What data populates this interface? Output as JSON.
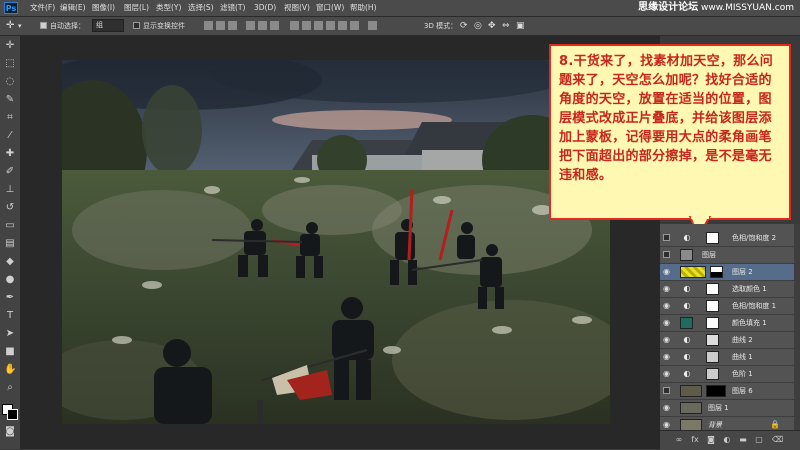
{
  "app": {
    "logo": "Ps"
  },
  "menu": [
    "文件(F)",
    "编辑(E)",
    "图像(I)",
    "图层(L)",
    "类型(Y)",
    "选择(S)",
    "滤镜(T)",
    "3D(D)",
    "视图(V)",
    "窗口(W)",
    "帮助(H)"
  ],
  "watermark": {
    "main": "思缘设计论坛",
    "sub": "www.MISSYUAN.com"
  },
  "options": {
    "auto_select_label": "自动选择：",
    "auto_select_value": "组",
    "show_transform_label": "显示变换控件",
    "mode_3d_label": "3D 模式："
  },
  "callout": {
    "text": "8.干货来了，找素材加天空，那么问题来了，天空怎么加呢？找好合适的角度的天空，放置在适当的位置，图层模式改成正片叠底，并给该图层添加上蒙板，记得要用大点的柔角画笔把下面超出的部分擦掉，是不是毫无违和感。"
  },
  "layers": [
    {
      "name": "色相/饱和度 2",
      "visible": false,
      "type": "adjustment",
      "icon": "hue-sat-icon",
      "selected": false
    },
    {
      "name": "图层",
      "visible": false,
      "type": "pixel",
      "icon": "",
      "selected": false
    },
    {
      "name": "图层 2",
      "visible": true,
      "type": "pixel",
      "icon": "",
      "selected": true
    },
    {
      "name": "选取颜色 1",
      "visible": true,
      "type": "adjustment",
      "icon": "selective-color-icon",
      "selected": false
    },
    {
      "name": "色相/饱和度 1",
      "visible": true,
      "type": "adjustment",
      "icon": "hue-sat-icon",
      "selected": false
    },
    {
      "name": "颜色填充 1",
      "visible": true,
      "type": "fill",
      "icon": "fill-icon",
      "selected": false
    },
    {
      "name": "曲线 2",
      "visible": true,
      "type": "adjustment",
      "icon": "curves-icon",
      "selected": false
    },
    {
      "name": "曲线 1",
      "visible": true,
      "type": "adjustment",
      "icon": "curves-icon",
      "selected": false
    },
    {
      "name": "色阶 1",
      "visible": true,
      "type": "adjustment",
      "icon": "levels-icon",
      "selected": false
    },
    {
      "name": "图层 6",
      "visible": false,
      "type": "pixel",
      "icon": "",
      "selected": false
    },
    {
      "name": "图层 1",
      "visible": true,
      "type": "pixel",
      "icon": "",
      "selected": false
    },
    {
      "name": "背景",
      "visible": true,
      "type": "pixel",
      "icon": "",
      "selected": false
    }
  ],
  "colors": {
    "callout_text": "#c7261c",
    "callout_bg": "#fff8b3",
    "callout_border": "#e22a1e",
    "fill_layer": "#1f6b60",
    "selected_layer": "#556c8a"
  }
}
